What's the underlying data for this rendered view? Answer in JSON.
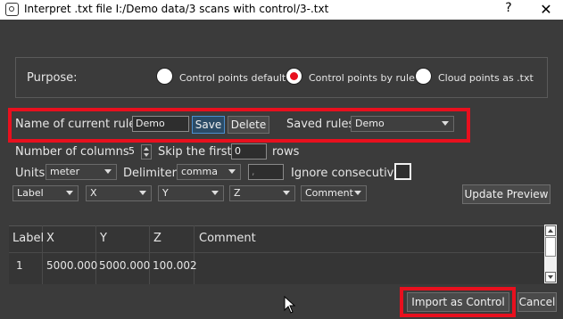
{
  "window": {
    "title": "Interpret .txt file I:/Demo data/3 scans with control/3-.txt",
    "help_label": "?",
    "close_label": "✕"
  },
  "purpose": {
    "label": "Purpose:",
    "options": [
      {
        "label": "Control points default",
        "selected": false
      },
      {
        "label": "Control points by rule",
        "selected": true
      },
      {
        "label": "Cloud points as .txt",
        "selected": false
      }
    ]
  },
  "rule": {
    "name_label": "Name of current rule",
    "name_value": "Demo",
    "save_label": "Save",
    "delete_label": "Delete",
    "saved_rules_label": "Saved rules",
    "saved_rules_value": "Demo"
  },
  "options": {
    "columns_label": "Number of columns",
    "columns_value": "5",
    "skip_label": "Skip the first",
    "skip_value": "0",
    "rows_label": "rows",
    "units_label": "Units",
    "units_value": "meter",
    "delimiter_label": "Delimiter",
    "delimiter_value": "comma",
    "delimiter_char": ",",
    "ignore_label": "Ignore consecutive",
    "ignore_checked": false
  },
  "column_map": [
    "Label",
    "X",
    "Y",
    "Z",
    "Comment"
  ],
  "update_preview_label": "Update Preview",
  "preview": {
    "headers": [
      "Label",
      "X",
      "Y",
      "Z",
      "Comment"
    ],
    "rows": [
      [
        "1",
        "5000.000",
        "5000.000",
        "100.002",
        ""
      ]
    ]
  },
  "footer": {
    "import_label": "Import as Control",
    "cancel_label": "Cancel"
  },
  "colors": {
    "highlight": "#e8101e",
    "background": "#3b3b3b"
  }
}
